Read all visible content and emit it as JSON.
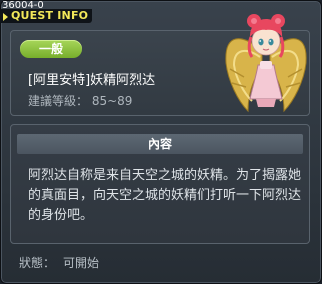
{
  "quest_id": "36004-0",
  "window_title": "QUEST INFO",
  "category": "一般",
  "quest_name": "[阿里安特]妖精阿烈达",
  "level_label": "建議等級：",
  "level_range": "85~89",
  "content_title": "內容",
  "content_text": "阿烈达自称是来自天空之城的妖精。为了揭露她的真面目，向天空之城的妖精们打听一下阿烈达的身份吧。",
  "status_label": "狀態：",
  "status_value": "可開始",
  "colors": {
    "title_yellow": "#f2e85a",
    "category_green": "#8cc63f",
    "panel_bg": "#353d46"
  },
  "icons": {
    "portrait": "winged-fairy-npc-portrait"
  }
}
